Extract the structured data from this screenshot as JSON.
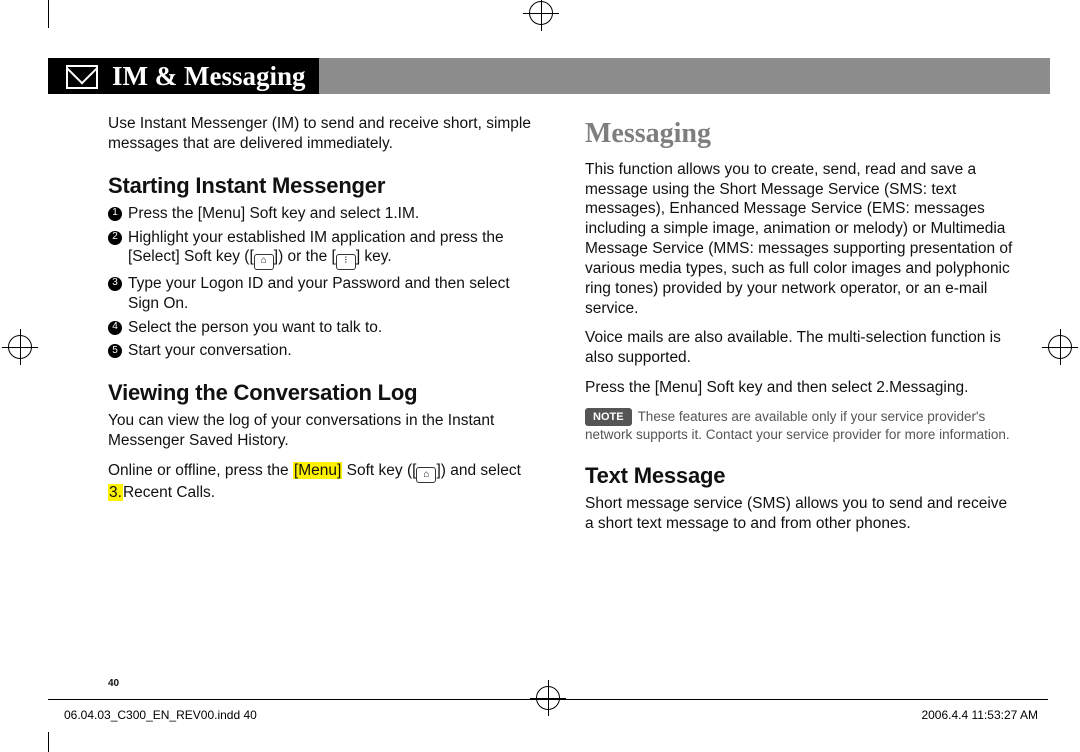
{
  "title_bar": {
    "title": "IM & Messaging"
  },
  "left": {
    "intro": "Use Instant Messenger (IM) to send and receive short, simple messages that are delivered immediately.",
    "sec1_heading": "Starting Instant Messenger",
    "s1": "Press the [Menu] Soft key and select 1.IM.",
    "s2a": "Highlight your established IM application and press the [Select] Soft key ([",
    "s2b": "]) or the [",
    "s2c": "] key.",
    "s3": "Type your Logon ID and your Password and then select Sign On.",
    "s4": "Select the person you want to talk to.",
    "s5": "Start your conversation.",
    "sec2_heading": "Viewing the Conversation Log",
    "log_p1": "You can view the log of your conversations in the Instant Messenger Saved History.",
    "log_p2a": "Online or offline, press the ",
    "log_p2_hl1": "[Menu]",
    "log_p2b": " Soft key ([",
    "log_p2c": "]) and select ",
    "log_p2_hl2": "3.",
    "log_p2d": "Recent Calls."
  },
  "right": {
    "heading": "Messaging",
    "p1": "This function allows you to create, send, read and save a message using the Short Message Service (SMS: text messages), Enhanced Message Service (EMS: messages including a simple image, animation or melody) or Multimedia Message Service (MMS: messages supporting presentation of various media types, such as full color images and polyphonic ring tones) provided by your network operator, or an e-mail service.",
    "p2": "Voice mails are also available. The multi-selection function is also supported.",
    "p3": "Press the [Menu] Soft key and then select 2.Messaging.",
    "note_label": "NOTE",
    "note_text": "These features are available only if your service provider's network supports it. Contact your service provider for more information.",
    "sec_text_heading": "Text Message",
    "text_p": "Short message service (SMS) allows you to send and receive a short text message to and from other phones."
  },
  "pagenum": "40",
  "footer": {
    "left": "06.04.03_C300_EN_REV00.indd   40",
    "right": "2006.4.4   11:53:27 AM"
  },
  "keys": {
    "soft": "⌂",
    "ok": "⁝"
  }
}
